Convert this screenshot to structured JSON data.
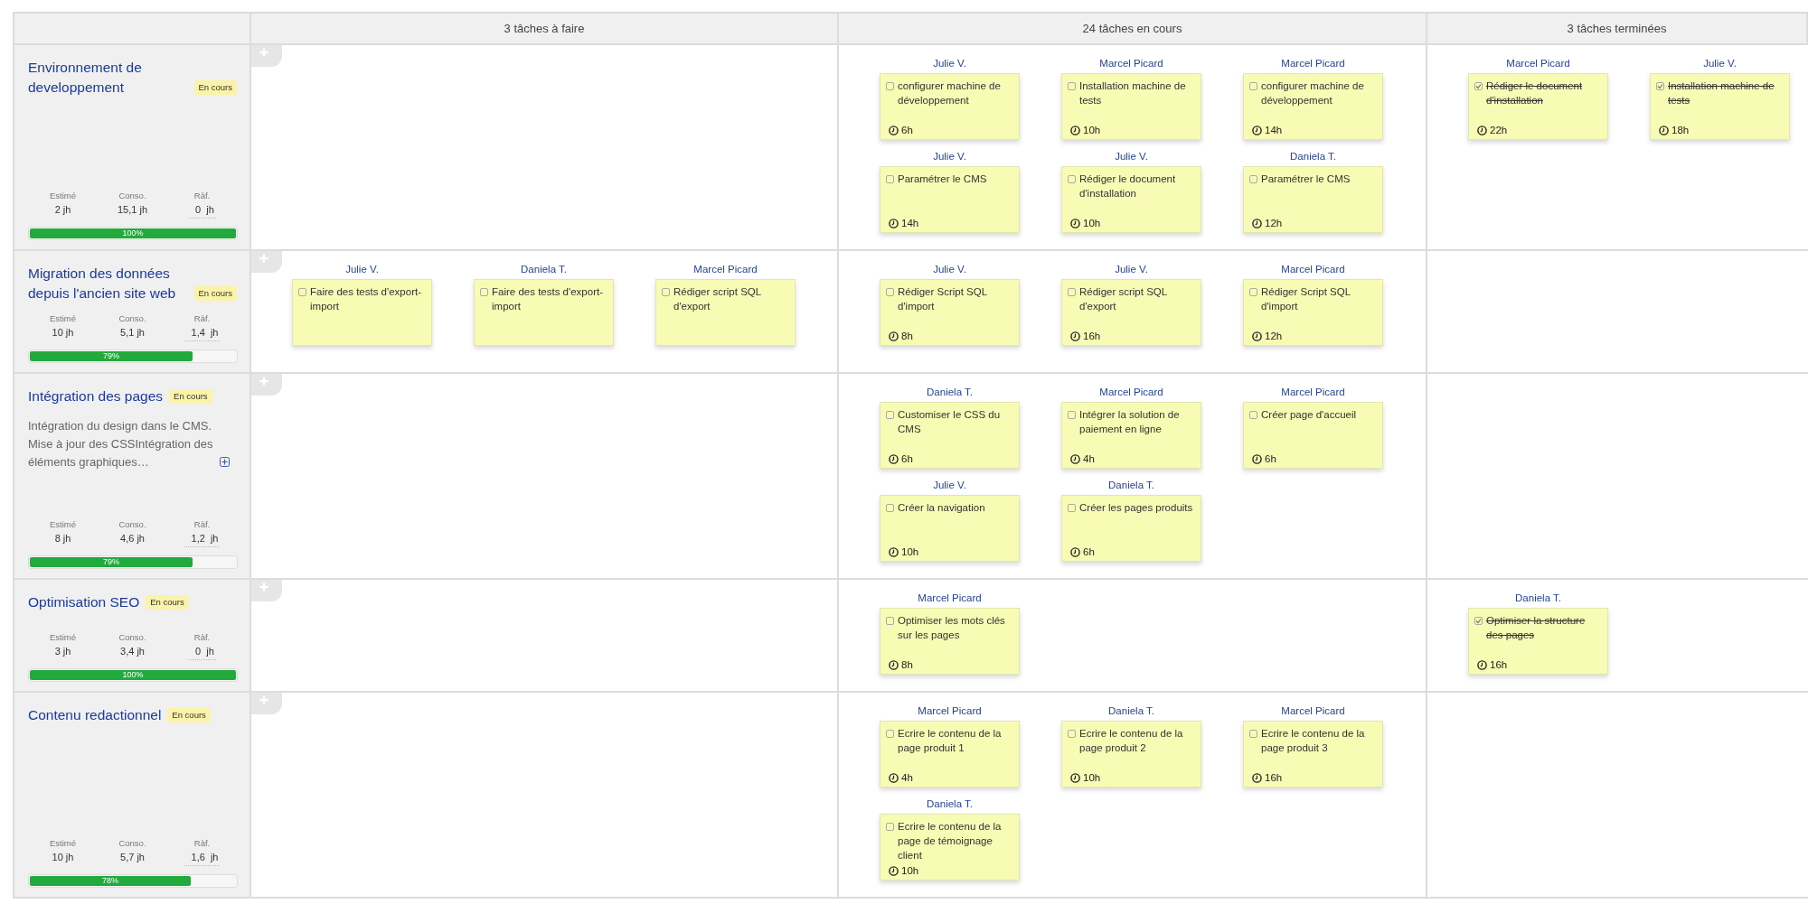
{
  "columns": [
    {
      "label": "3 tâches à faire"
    },
    {
      "label": "24 tâches en cours"
    },
    {
      "label": "3 tâches terminées"
    }
  ],
  "lanes": [
    {
      "title": "Environnement de developpement",
      "status": "En cours",
      "stats": [
        {
          "label": "Estimé",
          "value": "2 jh",
          "kind": "fixed"
        },
        {
          "label": "Conso.",
          "value": "15,1 jh",
          "kind": "fixed"
        },
        {
          "label": "Ràf.",
          "value": "0",
          "unit": "jh",
          "kind": "editable"
        }
      ],
      "progress": {
        "level": 1,
        "label": "100%"
      },
      "cells": [
        [],
        [
          {
            "assignee": "Julie V.",
            "title": "configurer machine de développement",
            "done": false,
            "hours": "6h"
          },
          {
            "assignee": "Marcel Picard",
            "title": "Installation machine de tests",
            "done": false,
            "hours": "10h"
          },
          {
            "assignee": "Marcel Picard",
            "title": "configurer machine de développement",
            "done": false,
            "hours": "14h"
          },
          {
            "assignee": "Julie V.",
            "title": "Paramétrer le CMS",
            "done": false,
            "hours": "14h"
          },
          {
            "assignee": "Julie V.",
            "title": "Rédiger le document d'installation",
            "done": false,
            "hours": "10h"
          },
          {
            "assignee": "Daniela T.",
            "title": "Paramétrer le CMS",
            "done": false,
            "hours": "12h"
          }
        ],
        [
          {
            "assignee": "Marcel Picard",
            "title": "Rédiger le document d'installation",
            "done": true,
            "hours": "22h"
          },
          {
            "assignee": "Julie V.",
            "title": "Installation machine de tests",
            "done": true,
            "hours": "18h"
          }
        ]
      ]
    },
    {
      "title": "Migration des données depuis l'ancien site web",
      "status": "En cours",
      "stats": [
        {
          "label": "Estimé",
          "value": "10 jh",
          "kind": "fixed"
        },
        {
          "label": "Conso.",
          "value": "5,1 jh",
          "kind": "fixed"
        },
        {
          "label": "Ràf.",
          "value": "1,4",
          "unit": "jh",
          "kind": "editable"
        }
      ],
      "progress": {
        "level": 0.79,
        "label": "79%"
      },
      "cells": [
        [
          {
            "assignee": "Julie V.",
            "title": "Faire des tests d'export-import",
            "done": false
          },
          {
            "assignee": "Daniela T.",
            "title": "Faire des tests d'export-import",
            "done": false
          },
          {
            "assignee": "Marcel Picard",
            "title": "Rédiger script SQL d'export",
            "done": false
          }
        ],
        [
          {
            "assignee": "Julie V.",
            "title": "Rédiger Script SQL d'import",
            "done": false,
            "hours": "8h"
          },
          {
            "assignee": "Julie V.",
            "title": "Rédiger script SQL d'export",
            "done": false,
            "hours": "16h"
          },
          {
            "assignee": "Marcel Picard",
            "title": "Rédiger Script SQL d'import",
            "done": false,
            "hours": "12h"
          }
        ],
        []
      ]
    },
    {
      "title": "Intégration des pages",
      "status": "En cours",
      "description": "Intégration du design dans le CMS. Mise à jour des CSSIntégration des éléments graphiques…",
      "stats": [
        {
          "label": "Estimé",
          "value": "8 jh",
          "kind": "fixed"
        },
        {
          "label": "Conso.",
          "value": "4,6 jh",
          "kind": "fixed"
        },
        {
          "label": "Ràf.",
          "value": "1,2",
          "unit": "jh",
          "kind": "editable"
        }
      ],
      "progress": {
        "level": 0.79,
        "label": "79%"
      },
      "cells": [
        [],
        [
          {
            "assignee": "Daniela T.",
            "title": "Customiser le CSS du CMS",
            "done": false,
            "hours": "6h"
          },
          {
            "assignee": "Marcel Picard",
            "title": "Intégrer la solution de paiement en ligne",
            "done": false,
            "hours": "4h"
          },
          {
            "assignee": "Marcel Picard",
            "title": "Créer page d'accueil",
            "done": false,
            "hours": "6h"
          },
          {
            "assignee": "Julie V.",
            "title": "Créer la navigation",
            "done": false,
            "hours": "10h"
          },
          {
            "assignee": "Daniela T.",
            "title": "Créer les pages produits",
            "done": false,
            "hours": "6h"
          }
        ],
        []
      ]
    },
    {
      "title": "Optimisation SEO",
      "status": "En cours",
      "stats": [
        {
          "label": "Estimé",
          "value": "3 jh",
          "kind": "fixed"
        },
        {
          "label": "Conso.",
          "value": "3,4 jh",
          "kind": "fixed"
        },
        {
          "label": "Ràf.",
          "value": "0",
          "unit": "jh",
          "kind": "editable"
        }
      ],
      "progress": {
        "level": 1,
        "label": "100%"
      },
      "cells": [
        [],
        [
          {
            "assignee": "Marcel Picard",
            "title": "Optimiser les mots clés sur les pages",
            "done": false,
            "hours": "8h"
          }
        ],
        [
          {
            "assignee": "Daniela T.",
            "title": "Optimiser la structure des pages",
            "done": true,
            "hours": "16h"
          }
        ]
      ]
    },
    {
      "title": "Contenu redactionnel",
      "status": "En cours",
      "stats": [
        {
          "label": "Estimé",
          "value": "10 jh",
          "kind": "fixed"
        },
        {
          "label": "Conso.",
          "value": "5,7 jh",
          "kind": "fixed"
        },
        {
          "label": "Ràf.",
          "value": "1,6",
          "unit": "jh",
          "kind": "editable"
        }
      ],
      "progress": {
        "level": 0.78,
        "label": "78%"
      },
      "cells": [
        [],
        [
          {
            "assignee": "Marcel Picard",
            "title": "Ecrire le contenu de la page produit 1",
            "done": false,
            "hours": "4h"
          },
          {
            "assignee": "Daniela T.",
            "title": "Ecrire le contenu de la page produit 2",
            "done": false,
            "hours": "10h"
          },
          {
            "assignee": "Marcel Picard",
            "title": "Ecrire le contenu de la page produit 3",
            "done": false,
            "hours": "16h"
          },
          {
            "assignee": "Daniela T.",
            "title": "Ecrire le contenu de la page de témoignage client",
            "done": false,
            "hours": "10h"
          }
        ],
        []
      ]
    }
  ]
}
